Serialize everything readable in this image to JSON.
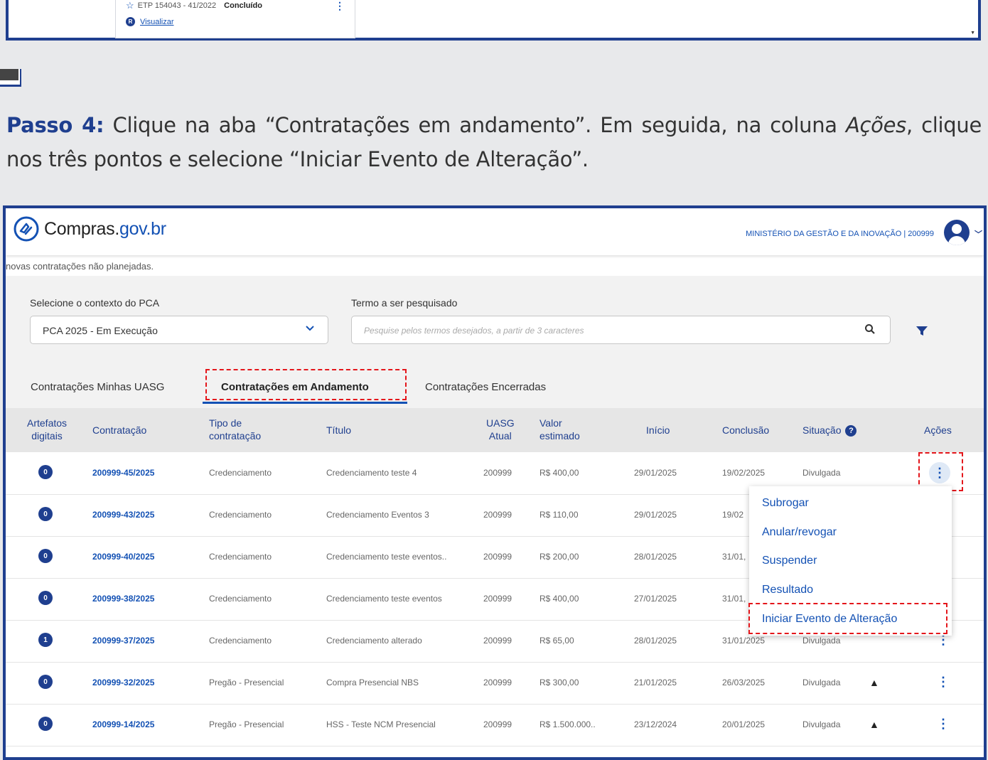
{
  "top_card": {
    "etp_code": "ETP 154043 - 41/2022",
    "etp_status": "Concluído",
    "visualize_link": "Visualizar",
    "r_badge": "R"
  },
  "instruction": {
    "step_label": "Passo 4:",
    "text_1": " Clique na aba “Contratações em andamento”. Em seguida, na coluna ",
    "text_italic": "Ações",
    "text_2": ", clique nos três pontos e selecione “Iniciar Evento de Alteração”."
  },
  "header": {
    "logo_prefix": "Compras.",
    "logo_suffix": "gov.br",
    "ministry": "MINISTÉRIO DA GESTÃO E DA INOVAÇÃO | 200999"
  },
  "notice": "novas contratações não planejadas.",
  "filters": {
    "context_label": "Selecione o contexto do PCA",
    "context_value": "PCA 2025 - Em Execução",
    "term_label": "Termo a ser pesquisado",
    "term_placeholder": "Pesquise pelos termos desejados, a partir de 3 caracteres"
  },
  "tabs": [
    {
      "label": "Contratações Minhas UASG"
    },
    {
      "label": "Contratações em Andamento"
    },
    {
      "label": "Contratações Encerradas"
    }
  ],
  "columns": {
    "artefatos_1": "Artefatos",
    "artefatos_2": "digitais",
    "contratacao": "Contratação",
    "tipo_1": "Tipo de",
    "tipo_2": "contratação",
    "titulo": "Título",
    "uasg_1": "UASG",
    "uasg_2": "Atual",
    "valor_1": "Valor",
    "valor_2": "estimado",
    "inicio": "Início",
    "conclusao": "Conclusão",
    "situacao": "Situação",
    "acoes": "Ações"
  },
  "rows": [
    {
      "badge": "0",
      "code": "200999-45/2025",
      "tipo": "Credenciamento",
      "titulo": "Credenciamento teste 4",
      "uasg": "200999",
      "valor": "R$ 400,00",
      "inicio": "29/01/2025",
      "conclusao": "19/02/2025",
      "situacao": "Divulgada"
    },
    {
      "badge": "0",
      "code": "200999-43/2025",
      "tipo": "Credenciamento",
      "titulo": "Credenciamento Eventos 3",
      "uasg": "200999",
      "valor": "R$ 110,00",
      "inicio": "29/01/2025",
      "conclusao": "19/02",
      "situacao": ""
    },
    {
      "badge": "0",
      "code": "200999-40/2025",
      "tipo": "Credenciamento",
      "titulo": "Credenciamento teste eventos..",
      "uasg": "200999",
      "valor": "R$ 200,00",
      "inicio": "28/01/2025",
      "conclusao": "31/01,",
      "situacao": ""
    },
    {
      "badge": "0",
      "code": "200999-38/2025",
      "tipo": "Credenciamento",
      "titulo": "Credenciamento teste eventos",
      "uasg": "200999",
      "valor": "R$ 400,00",
      "inicio": "27/01/2025",
      "conclusao": "31/01,",
      "situacao": ""
    },
    {
      "badge": "1",
      "code": "200999-37/2025",
      "tipo": "Credenciamento",
      "titulo": "Credenciamento alterado",
      "uasg": "200999",
      "valor": "R$ 65,00",
      "inicio": "28/01/2025",
      "conclusao": "31/01/2025",
      "situacao": "Divulgada"
    },
    {
      "badge": "0",
      "code": "200999-32/2025",
      "tipo": "Pregão - Presencial",
      "titulo": "Compra Presencial NBS",
      "uasg": "200999",
      "valor": "R$ 300,00",
      "inicio": "21/01/2025",
      "conclusao": "26/03/2025",
      "situacao": "Divulgada"
    },
    {
      "badge": "0",
      "code": "200999-14/2025",
      "tipo": "Pregão - Presencial",
      "titulo": "HSS - Teste NCM Presencial",
      "uasg": "200999",
      "valor": "R$ 1.500.000..",
      "inicio": "23/12/2024",
      "conclusao": "20/01/2025",
      "situacao": "Divulgada"
    }
  ],
  "actions_menu": [
    {
      "label": "Subrogar"
    },
    {
      "label": "Anular/revogar"
    },
    {
      "label": "Suspender"
    },
    {
      "label": "Resultado"
    },
    {
      "label": "Iniciar Evento de Alteração"
    }
  ],
  "icons": {
    "kebab": "⋮",
    "warning": "▲",
    "chevron": "⌄",
    "help": "?"
  },
  "colors": {
    "brand": "#1351b4",
    "frame": "#1f3f8f",
    "highlight": "#e4161b"
  }
}
